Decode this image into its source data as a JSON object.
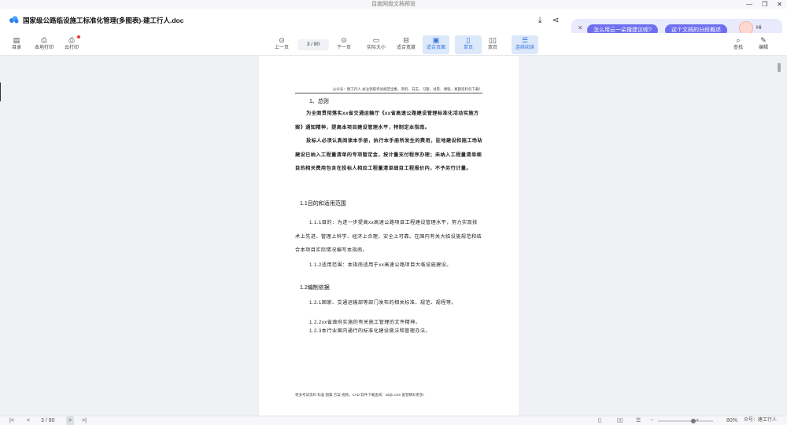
{
  "app": {
    "title": "百度网盘文档预览"
  },
  "doc": {
    "title": "国家级公路临设施工标准化管理(多图表)-建工行人.doc"
  },
  "ai_panel": {
    "suggestions": [
      "怎么用云一朵搜建议呢?",
      "这个文档的分段概述"
    ],
    "greeting": "Hi"
  },
  "toolbar": {
    "left": [
      {
        "label": "目录",
        "icon": "list-icon"
      },
      {
        "label": "本地打印",
        "icon": "printer-icon"
      },
      {
        "label": "云打印",
        "icon": "cloud-print-icon"
      }
    ],
    "prev": "上一页",
    "next": "下一页",
    "page_current": "3",
    "page_total": "80",
    "views": [
      {
        "label": "实际大小",
        "active": false
      },
      {
        "label": "适合宽度",
        "active": false
      },
      {
        "label": "适合页面",
        "active": true
      },
      {
        "label": "单页",
        "active": true
      },
      {
        "label": "双页",
        "active": false
      },
      {
        "label": "连续阅读",
        "active": true
      }
    ],
    "right": [
      {
        "label": "查找",
        "icon": "search-icon"
      },
      {
        "label": "编辑",
        "icon": "pencil-icon"
      }
    ]
  },
  "page": {
    "header": "公众号：建工行人  关注领取考试规范全集、资料、日志、习题、试卷、课程、真题资料包下载！",
    "heading1": "1、总则",
    "para1": "为全面贯彻落实xx省交通运输厅《xx省高速公路建设管理标准化活动实施方案》通知精神，提高本项目建设管理水平，特制定本指南。",
    "para2": "投标人必须认真阅读本手册，执行本手册所发生的费用，驻地建设和施工场站建设已纳入工程量清单的专项暂定金，按计量支付程序办理；未纳入工程量清单细目的相关费用包含在投标人相应工程量清单细目工程报价内，不予另行计量。",
    "heading2": "1.1目的和适用范围",
    "para3": "1.1.1目的：为进一步提高xx高速公路项目工程建设管理水平，努力实现技术上先进、管理上科学、经济上合理、安全上可靠。在国内有关大临设施规范和结合本项目实际情况编写本指南。",
    "para4": "1.1.2适用范围：本指南适用于xx高速公路项目大临设施建设。",
    "heading3": "1.2编制依据",
    "para5": "1.2.1国家、交通运输部等部门发布的相关标准、规范、规程等。",
    "para6": "1.2.2xx省政府实施的有关施工管理的文件精神。",
    "para7": "1.2.3本行业国内通行的标准化建设做法和管理办法。",
    "footer": "更多考试资料 标准 图集 方案 视频，CAD 软件下载查阅：wlzjk.com 富登精彩更多!"
  },
  "bottom": {
    "page_current": "3",
    "page_total": "80",
    "zoom": "80%",
    "watermark": "众号：建工行人"
  }
}
